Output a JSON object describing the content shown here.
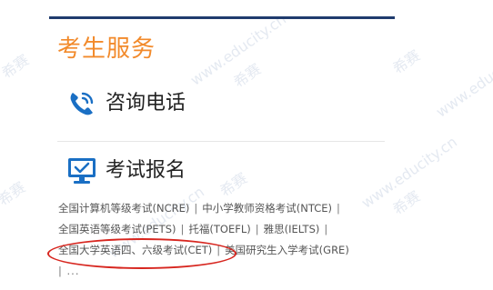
{
  "colors": {
    "accent": "#f28a2b",
    "rule": "#1f3b6e",
    "icon_blue": "#1a6fc4",
    "highlight": "#d7261f"
  },
  "section": {
    "title": "考生服务"
  },
  "services": [
    {
      "label": "咨询电话",
      "icon": "phone-icon"
    },
    {
      "label": "考试报名",
      "icon": "monitor-icon"
    }
  ],
  "links": {
    "line1": [
      "全国计算机等级考试(NCRE)",
      "中小学教师资格考试(NTCE)"
    ],
    "line2": [
      "全国英语等级考试(PETS)",
      "托福(TOEFL)",
      "雅思(IELTS)"
    ],
    "line3": [
      "全国大学英语四、六级考试(CET)",
      "美国研究生入学考试(GRE)"
    ],
    "separator": "|",
    "more": "| ..."
  },
  "watermark": {
    "site": "www.educity.cn",
    "brand": "希赛"
  }
}
